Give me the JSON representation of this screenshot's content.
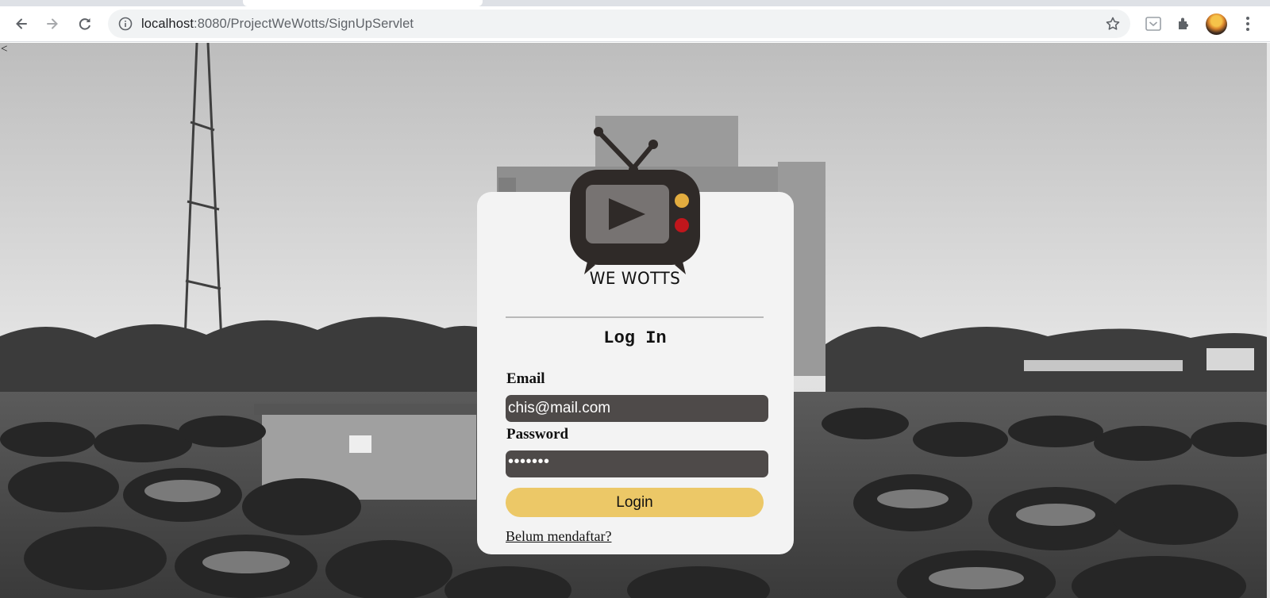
{
  "browser": {
    "url_host": "localhost",
    "url_path": ":8080/ProjectWeWotts/SignUpServlet",
    "icons": {
      "back": "back-arrow-icon",
      "forward": "forward-arrow-icon",
      "reload": "reload-icon",
      "site_info": "info-icon",
      "bookmark": "star-icon",
      "extension_1": "pocket-icon",
      "extensions": "puzzle-icon",
      "profile": "avatar",
      "menu": "kebab-menu-icon"
    }
  },
  "page": {
    "back_caret": "<",
    "brand_name": "WE WOTTS",
    "heading": "Log In",
    "email_label": "Email",
    "email_value": "chis@mail.com",
    "password_label": "Password",
    "password_masked": "•••••••",
    "login_button": "Login",
    "signup_link": "Belum mendaftar?"
  },
  "colors": {
    "card_bg": "#f3f3f3",
    "field_bg": "#4e4a49",
    "button_bg": "#ecc867",
    "tv_body": "#2f2a28",
    "tv_knob_top": "#e2ac3f",
    "tv_knob_bottom": "#c0161c"
  }
}
